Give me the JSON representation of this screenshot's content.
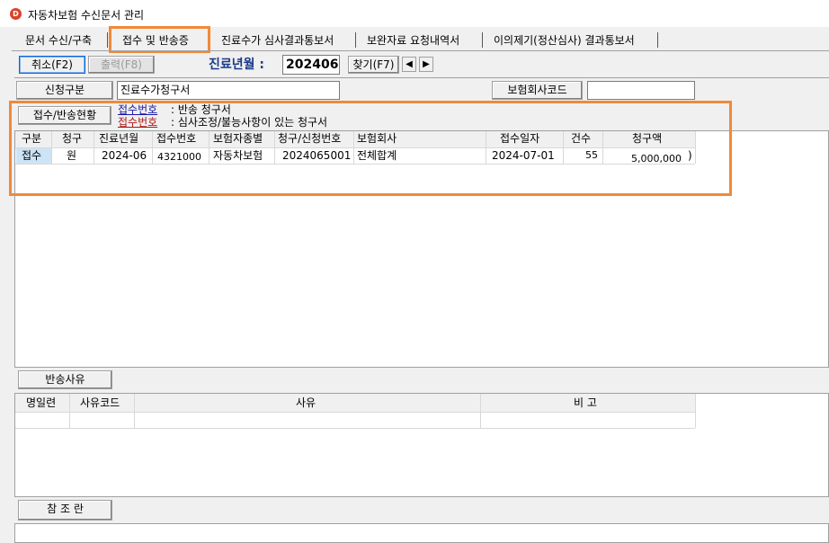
{
  "window": {
    "title": "자동차보험 수신문서 관리",
    "icon": "app-logo-icon"
  },
  "tabs": [
    {
      "label": "문서 수신/구축"
    },
    {
      "label": "접수 및 반송증",
      "active": true
    },
    {
      "label": "진료수가 심사결과통보서"
    },
    {
      "label": "보완자료 요청내역서"
    },
    {
      "label": "이의제기(정산심사) 결과통보서"
    }
  ],
  "toolbar": {
    "cancel_label": "취소(F2)",
    "print_label": "출력(F8)",
    "period_label": "진료년월 :",
    "period_value": "202406",
    "search_label": "찾기(F7)",
    "prev_icon": "triangle-left-icon",
    "next_icon": "triangle-right-icon"
  },
  "filter": {
    "request_type_label": "신청구분",
    "request_type_value": "진료수가청구서",
    "insurer_code_label": "보험회사코드",
    "insurer_code_value": ""
  },
  "status": {
    "button_label": "접수/반송현황",
    "legend": [
      {
        "link": "접수번호",
        "desc": ": 반송 청구서",
        "color": "#1a1aa8"
      },
      {
        "link": "접수번호",
        "desc": ": 심사조정/불능사항이 있는 청구서",
        "color": "#b01818"
      }
    ]
  },
  "grid": {
    "columns": [
      "구분",
      "청구",
      "진료년월",
      "접수번호",
      "보험자종별",
      "청구/신청번호",
      "보험회사",
      "접수일자",
      "건수",
      "청구액"
    ],
    "rows": [
      [
        "접수",
        "원",
        "2024-06",
        "4321000",
        "자동차보험",
        "2024065001",
        "전체합계",
        "2024-07-01",
        "55",
        "5,000,000"
      ]
    ],
    "trailing_char": ")"
  },
  "return_reason": {
    "button_label": "반송사유",
    "columns": [
      "명일련",
      "사유코드",
      "사유",
      "비 고"
    ]
  },
  "reference": {
    "button_label": "참 조 란"
  },
  "colors": {
    "highlight_box": "#f08a3a",
    "selected_cell": "#cde4f7",
    "period_label": "#1a3a8a"
  }
}
